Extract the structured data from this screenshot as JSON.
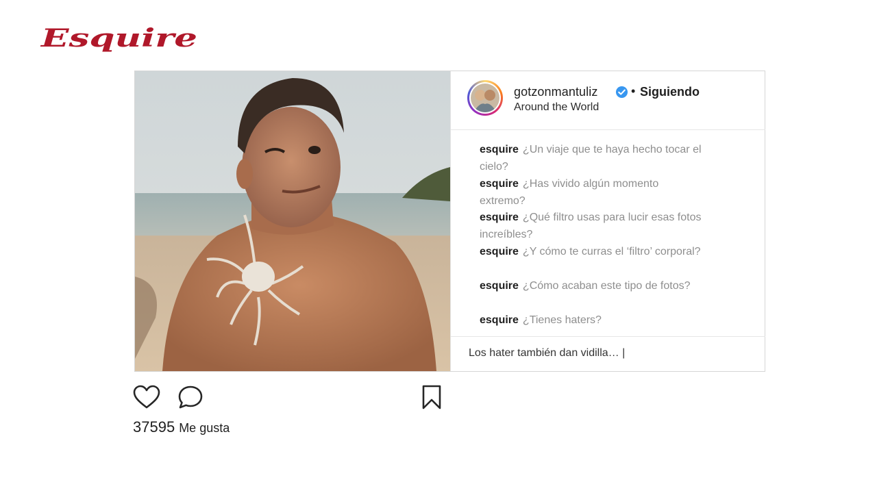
{
  "brand": {
    "logo_text": "Esquire",
    "color": "#b0182a"
  },
  "post": {
    "username": "gotzonmantuliz",
    "verified": true,
    "separator": "•",
    "follow_status": "Siguiendo",
    "location": "Around the World",
    "comments": [
      {
        "author": "esquire",
        "text": "¿Un viaje que te haya hecho tocar el cielo?"
      },
      {
        "author": "esquire",
        "text": "¿Has vivido algún momento extremo?"
      },
      {
        "author": "esquire",
        "text": "¿Qué filtro usas para lucir esas fotos increíbles?"
      },
      {
        "author": "esquire",
        "text": "¿Y cómo te curras el ‘filtro’ corporal?"
      },
      {
        "author": "esquire",
        "text": "¿Cómo acaban este tipo de fotos?"
      },
      {
        "author": "esquire",
        "text": "¿Tienes haters?"
      }
    ],
    "reply_input": "Los hater también dan vidilla… |",
    "likes_count": "37595",
    "likes_label": "Me gusta"
  },
  "icons": {
    "like": "heart-icon",
    "comment": "comment-bubble-icon",
    "save": "bookmark-icon",
    "verified": "verified-badge-icon"
  },
  "colors": {
    "verified_blue": "#3897f0",
    "muted_text": "#8e8e8e"
  }
}
